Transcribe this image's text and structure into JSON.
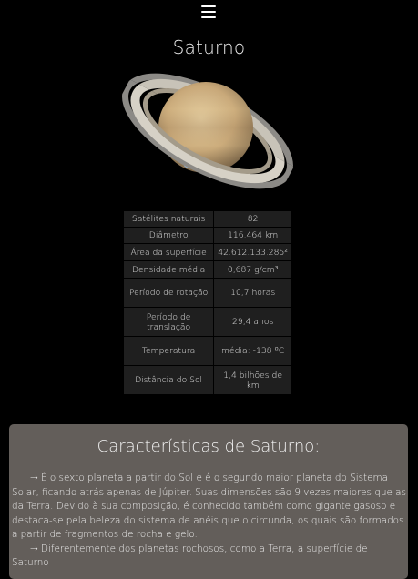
{
  "header": {
    "menu_icon": "hamburger-menu-icon"
  },
  "page": {
    "title": "Saturno"
  },
  "facts": [
    {
      "label": "Satélites naturais",
      "value": "82"
    },
    {
      "label": "Diâmetro",
      "value": "116.464 km"
    },
    {
      "label": "Área da superfície",
      "value": "42.612.133.285²"
    },
    {
      "label": "Densidade média",
      "value": "0,687 g/cm³"
    },
    {
      "label": "Período de rotação",
      "value": "10,7 horas"
    },
    {
      "label": "Período de translação",
      "value": "29,4 anos"
    },
    {
      "label": "Temperatura",
      "value": "média: -138 ºC"
    },
    {
      "label": "Distância do Sol",
      "value": "1,4 bilhões de km"
    }
  ],
  "characteristics": {
    "title": "Características de Saturno:",
    "paragraphs": [
      "→ É o sexto planeta a partir do Sol e é o segundo maior planeta do Sistema Solar, ficando atrás apenas de Júpiter. Suas dimensões são 9 vezes maiores que as da Terra. Devido à sua composição, é conhecido também como gigante gasoso e destaca-se pela beleza do sistema de anéis que o circunda, os quais são formados a partir de fragmentos de rocha e gelo.",
      "→ Diferentemente dos planetas rochosos, como a Terra, a superfície de Saturno"
    ]
  }
}
